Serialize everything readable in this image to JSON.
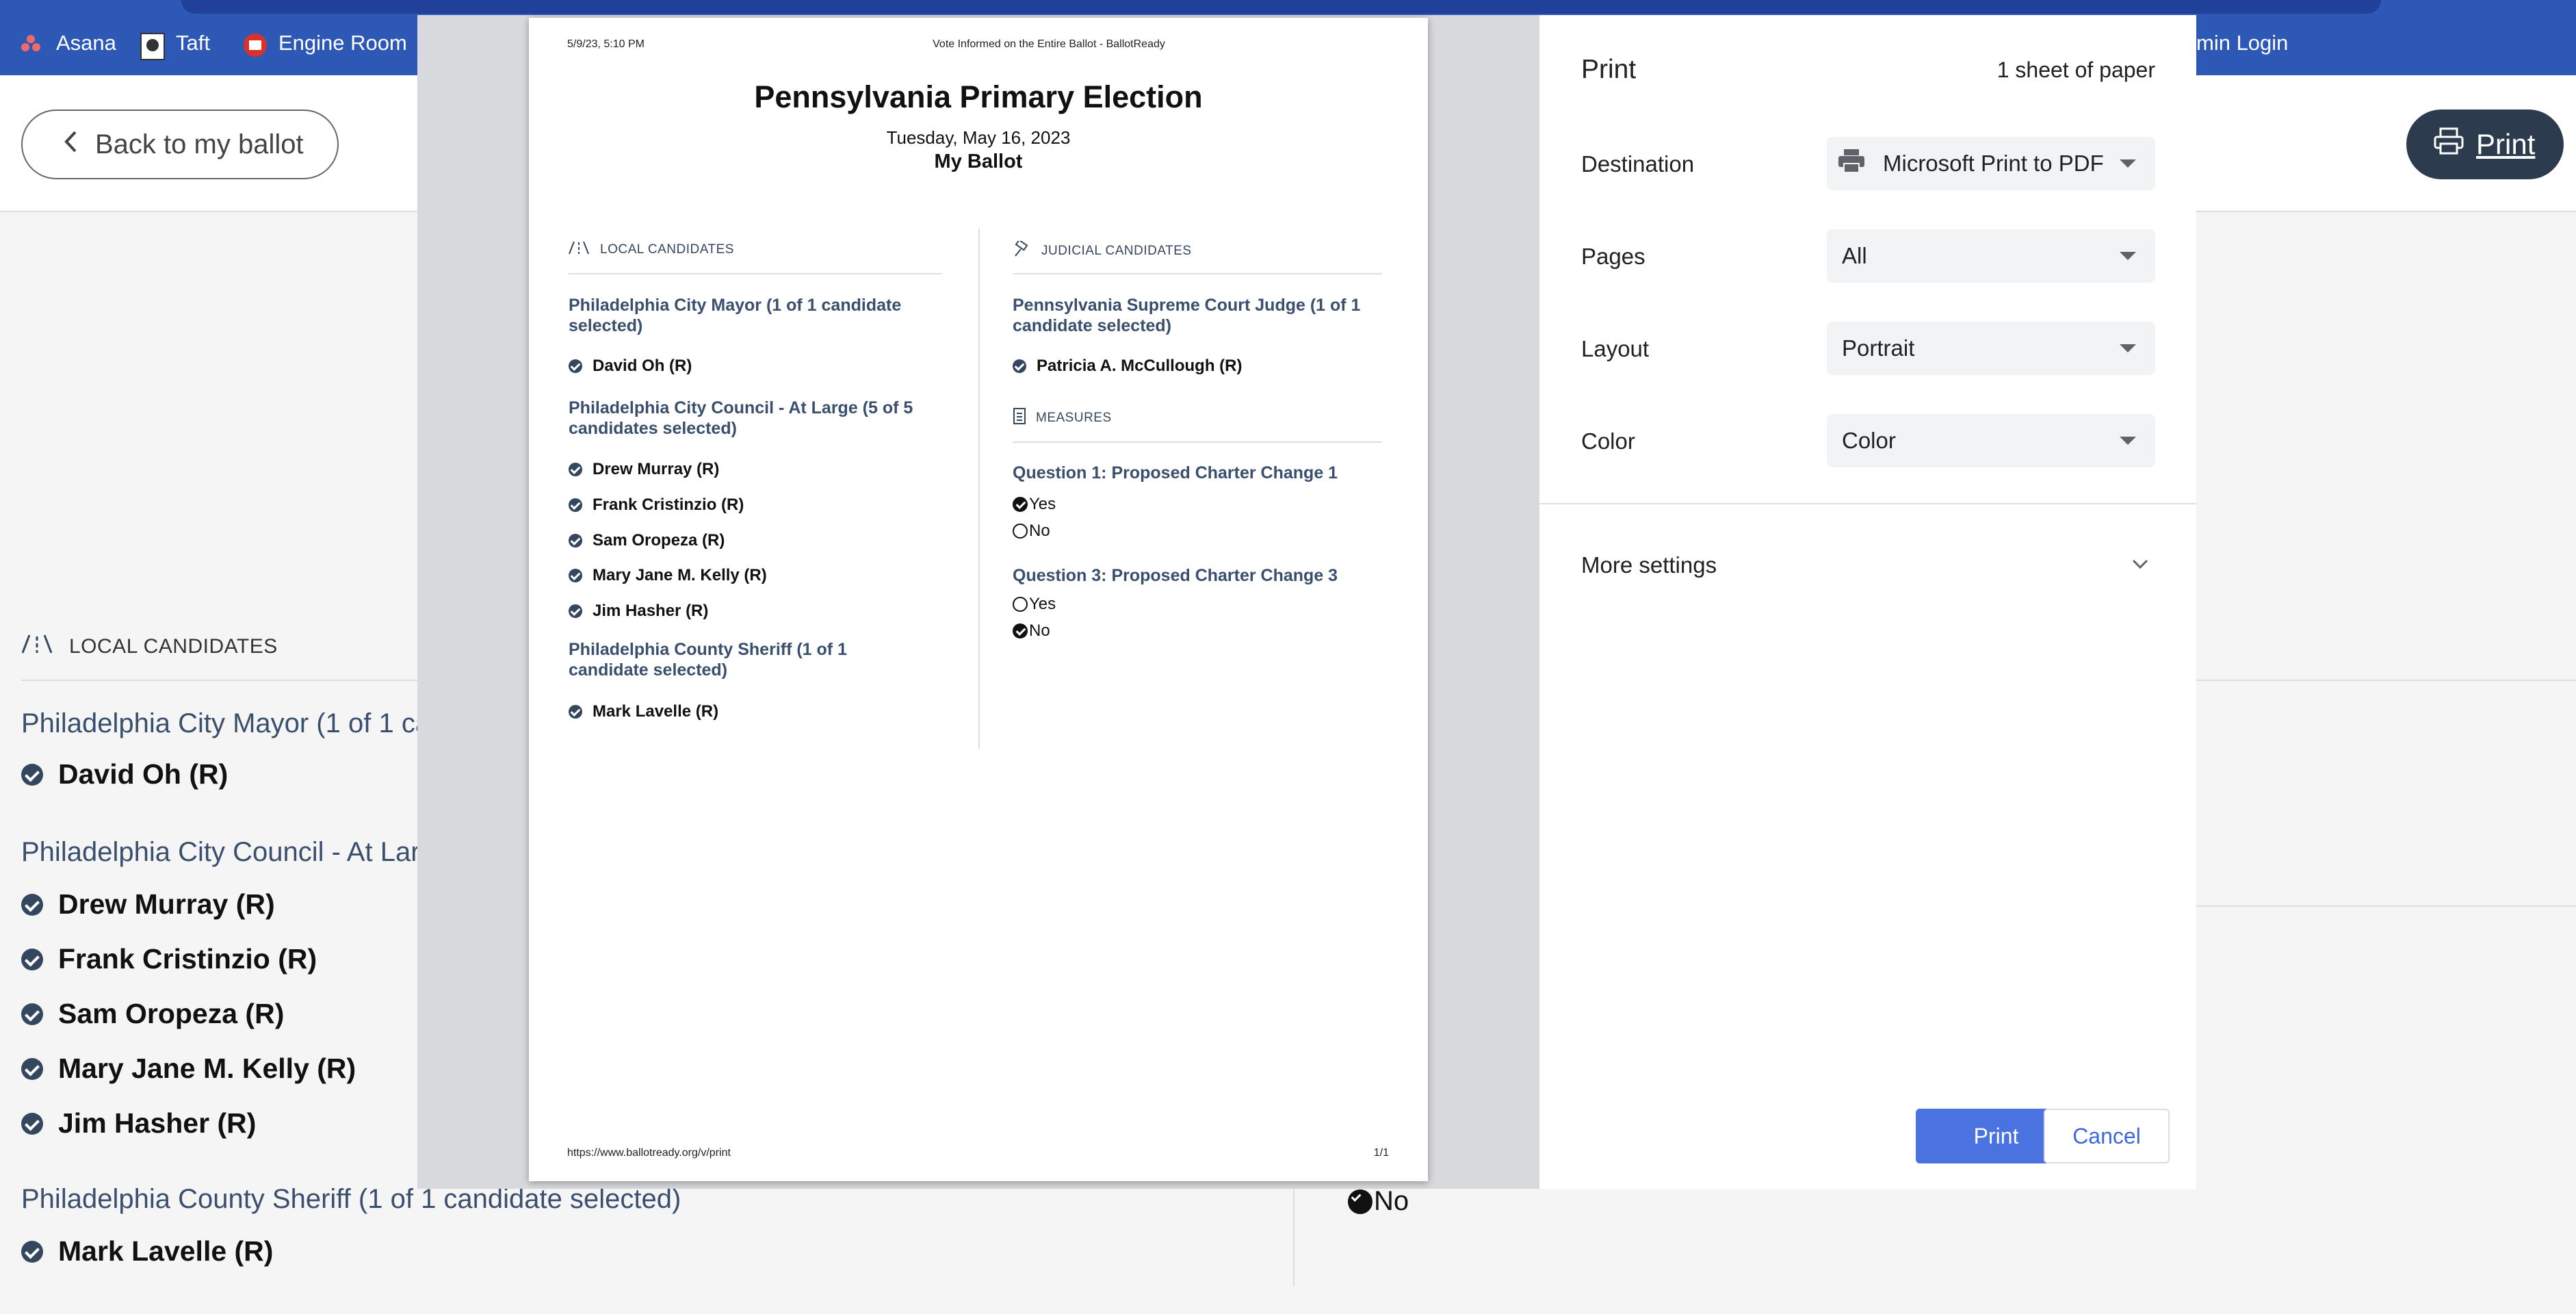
{
  "browser": {
    "bookmarks": [
      {
        "label": "Asana",
        "icon": "asana-icon"
      },
      {
        "label": "Taft",
        "icon": "taft-icon"
      },
      {
        "label": "Engine Room",
        "icon": "engine-room-icon"
      }
    ],
    "admin_login": "min Login"
  },
  "page": {
    "back_label": "Back to my ballot",
    "print_label": "Print",
    "local_section": "LOCAL CANDIDATES",
    "mayor_race_partial": "Philadelphia City Mayor (1 of 1 ca",
    "mayor_cand": "David Oh (R)",
    "council_race_partial": "Philadelphia City Council - At Lar",
    "council_cands": [
      "Drew Murray (R)",
      "Frank Cristinzio (R)",
      "Sam Oropeza (R)",
      "Mary Jane M. Kelly (R)",
      "Jim Hasher (R)"
    ],
    "sheriff_race": "Philadelphia County Sheriff (1 of 1 candidate selected)",
    "sheriff_cand": "Mark Lavelle (R)",
    "visible_no": "No"
  },
  "preview": {
    "header_left": "5/9/23, 5:10 PM",
    "header_center": "Vote Informed on the Entire Ballot - BallotReady",
    "title": "Pennsylvania Primary Election",
    "date": "Tuesday, May 16, 2023",
    "subtitle": "My Ballot",
    "local_section": "LOCAL CANDIDATES",
    "judicial_section": "JUDICIAL CANDIDATES",
    "measures_section": "MEASURES",
    "mayor_race": "Philadelphia City Mayor (1 of 1 candidate selected)",
    "mayor_cand": "David Oh (R)",
    "council_race": "Philadelphia City Council - At Large (5 of 5 candidates selected)",
    "council_cands": [
      "Drew Murray (R)",
      "Frank Cristinzio (R)",
      "Sam Oropeza (R)",
      "Mary Jane M. Kelly (R)",
      "Jim Hasher (R)"
    ],
    "sheriff_race": "Philadelphia County Sheriff (1 of 1 candidate selected)",
    "sheriff_cand": "Mark Lavelle (R)",
    "judge_race": "Pennsylvania Supreme Court Judge (1 of 1 candidate selected)",
    "judge_cand": "Patricia A. McCullough (R)",
    "q1": "Question 1: Proposed Charter Change 1",
    "q1_yes": "Yes",
    "q1_no": "No",
    "q3": "Question 3: Proposed Charter Change 3",
    "q3_yes": "Yes",
    "q3_no": "No",
    "footer_url": "https://www.ballotready.org/v/print",
    "footer_page": "1/1"
  },
  "print_dialog": {
    "title": "Print",
    "sheets": "1 sheet of paper",
    "destination_label": "Destination",
    "destination_value": "Microsoft Print to PDF",
    "pages_label": "Pages",
    "pages_value": "All",
    "layout_label": "Layout",
    "layout_value": "Portrait",
    "color_label": "Color",
    "color_value": "Color",
    "more_settings": "More settings",
    "print_button": "Print",
    "cancel_button": "Cancel"
  },
  "colors": {
    "accent": "#2e58b5",
    "print_button": "#4a72e0",
    "race_title": "#3a4f6e",
    "dark_button": "#2d3b4f"
  }
}
